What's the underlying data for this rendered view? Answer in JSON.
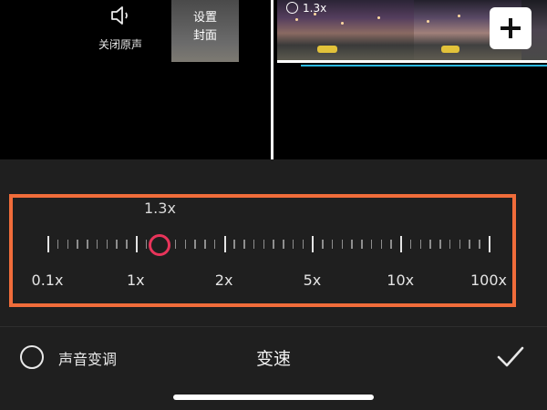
{
  "timeline": {
    "mute_label": "关闭原声",
    "cover_label_line1": "设置",
    "cover_label_line2": "封面",
    "clip_speed_badge": "1.3x",
    "add_icon": "plus-icon",
    "mute_icon": "speaker-icon"
  },
  "speed_panel": {
    "current_speed": "1.3x",
    "slider_value": 1.3,
    "scale_labels": [
      "0.1x",
      "1x",
      "2x",
      "5x",
      "10x",
      "100x"
    ],
    "accent_color": "#e8345a",
    "highlight_color": "#f06c3a"
  },
  "bottom_bar": {
    "pitch_label": "声音变调",
    "title": "变速",
    "pitch_checked": false,
    "confirm_icon": "checkmark-icon"
  }
}
